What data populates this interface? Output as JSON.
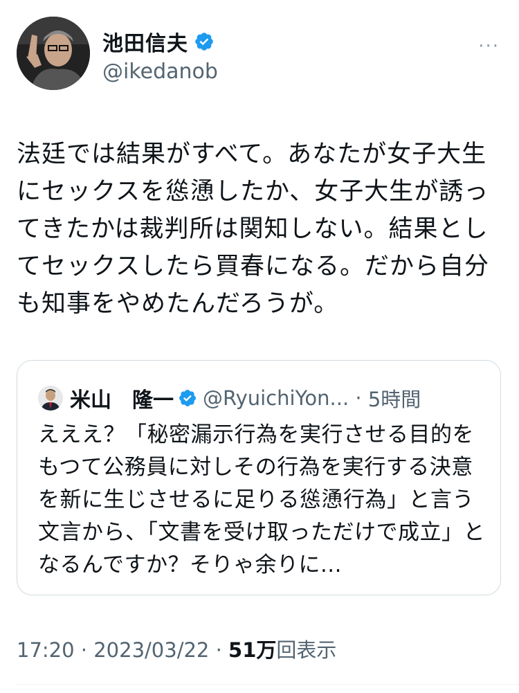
{
  "author": {
    "name": "池田信夫",
    "handle": "@ikedanob"
  },
  "more_label": "···",
  "tweet": {
    "text": "法廷では結果がすべて。あなたが女子大生にセックスを慫慂したか、女子大生が誘ってきたかは裁判所は関知しない。結果としてセックスしたら買春になる。だから自分も知事をやめたんだろうが。"
  },
  "quote": {
    "name": "米山　隆一",
    "handle": "@RyuichiYon...",
    "time": "5時間",
    "text": "えええ？「秘密漏示行為を実行させる目的をもつて公務員に対しその行為を実行する決意を新に生じさせるに足りる慫慂行為」と言う文言から、「文書を受け取っただけで成立」となるんですか？そりゃ余りに..."
  },
  "meta": {
    "time": "17:20",
    "date": "2023/03/22",
    "views_count": "51万",
    "views_label": "回表示"
  },
  "colors": {
    "verified": "#1d9bf0",
    "secondary_text": "#536471",
    "border": "#cfd9de"
  }
}
